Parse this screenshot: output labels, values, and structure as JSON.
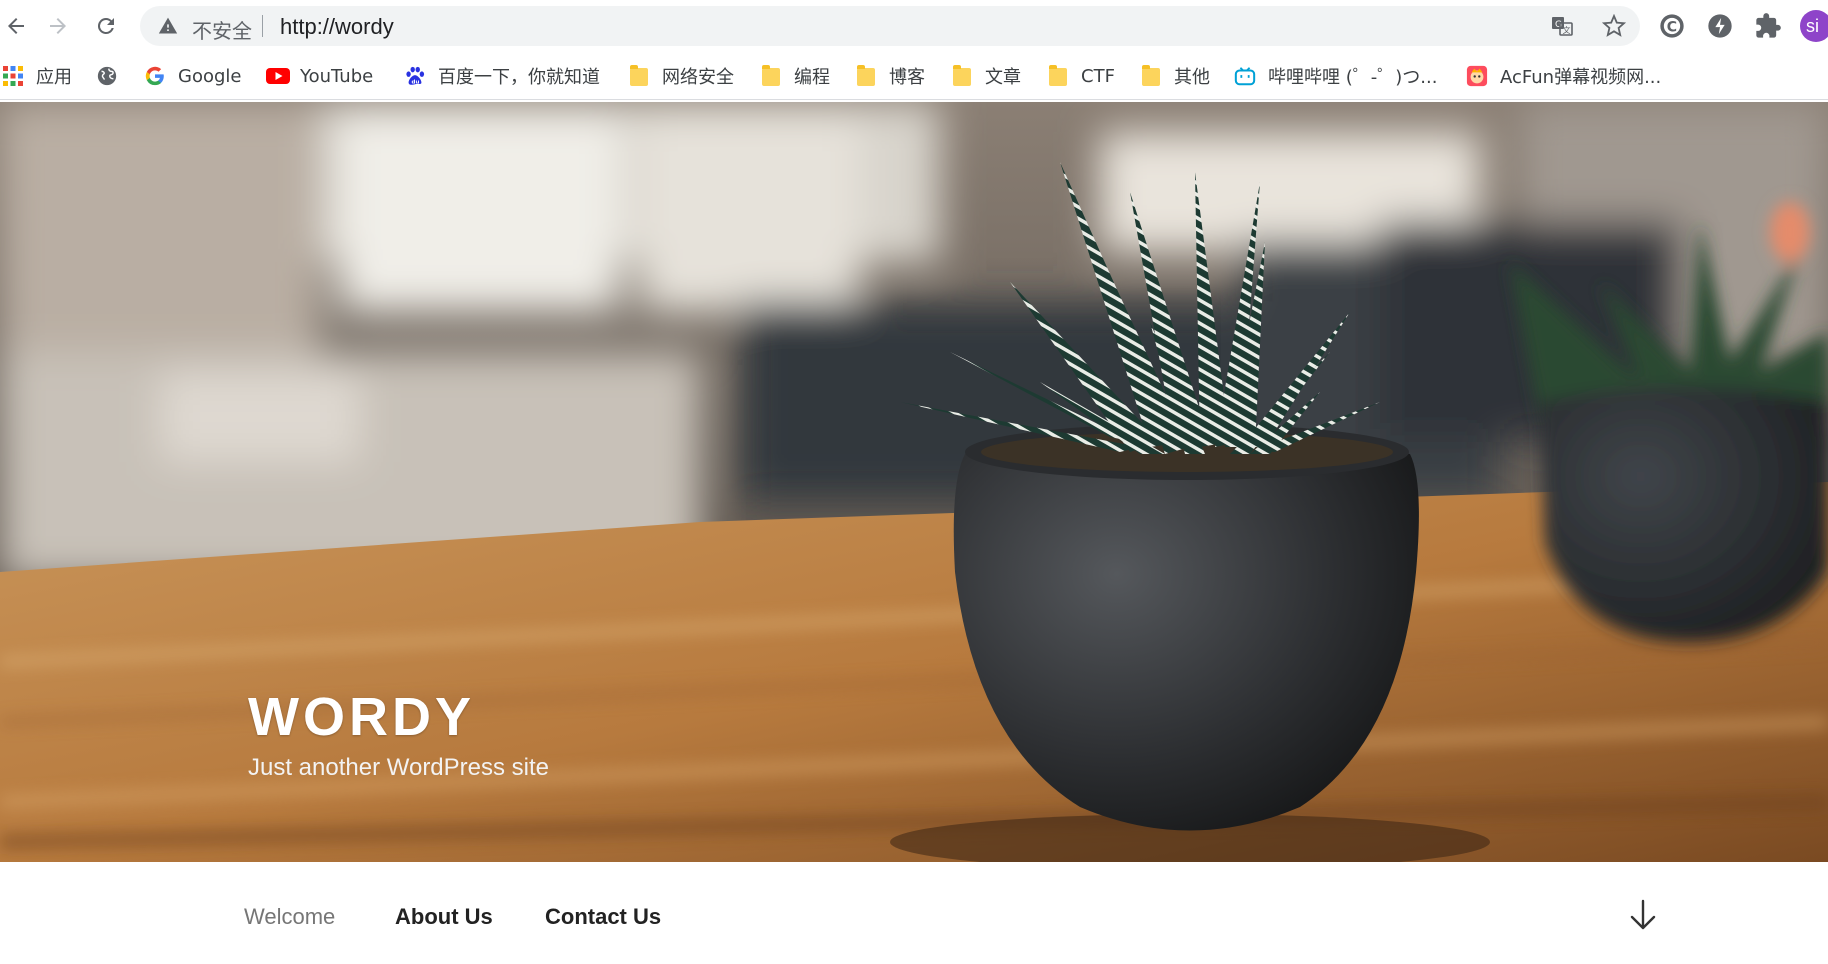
{
  "browser": {
    "security_label": "不安全",
    "url": "http://wordy",
    "avatar_text": "si"
  },
  "bookmarks": [
    {
      "label": "应用",
      "icon": "apps-grid-icon"
    },
    {
      "label": "",
      "icon": "globe-icon"
    },
    {
      "label": "Google",
      "icon": "google-icon"
    },
    {
      "label": "YouTube",
      "icon": "youtube-icon"
    },
    {
      "label": "百度一下，你就知道",
      "icon": "baidu-icon"
    },
    {
      "label": "网络安全",
      "icon": "folder-icon"
    },
    {
      "label": "编程",
      "icon": "folder-icon"
    },
    {
      "label": "博客",
      "icon": "folder-icon"
    },
    {
      "label": "文章",
      "icon": "folder-icon"
    },
    {
      "label": "CTF",
      "icon": "folder-icon"
    },
    {
      "label": "其他",
      "icon": "folder-icon"
    },
    {
      "label": "哔哩哔哩 (゜-゜)つ...",
      "icon": "bilibili-icon"
    },
    {
      "label": "AcFun弹幕视频网...",
      "icon": "acfun-icon"
    }
  ],
  "site": {
    "title": "WORDY",
    "description": "Just another WordPress site"
  },
  "site_nav": {
    "items": [
      {
        "label": "Welcome",
        "current": true
      },
      {
        "label": "About Us",
        "current": false
      },
      {
        "label": "Contact Us",
        "current": false
      }
    ]
  },
  "colors": {
    "accent_avatar": "#8e44c9",
    "omnibox_bg": "#f1f3f4",
    "folder": "#fcd45c"
  }
}
